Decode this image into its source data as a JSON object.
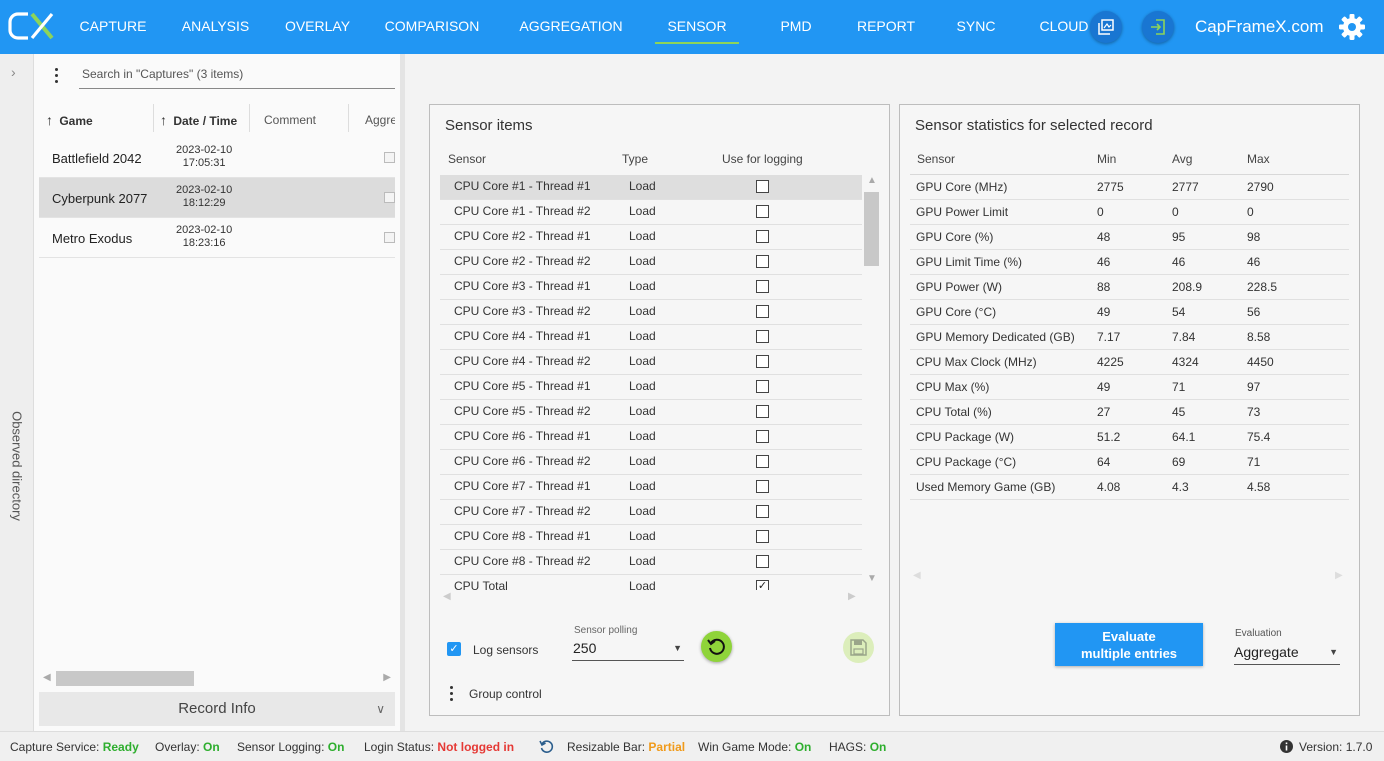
{
  "app": {
    "brand": "CapFrameX.com",
    "logo_text": "CX",
    "accent_color": "#2196f3",
    "active_tab_indicator_color": "#8dd45a"
  },
  "nav": {
    "tabs": [
      {
        "label": "CAPTURE",
        "active": false
      },
      {
        "label": "ANALYSIS",
        "active": false
      },
      {
        "label": "OVERLAY",
        "active": false
      },
      {
        "label": "COMPARISON",
        "active": false
      },
      {
        "label": "AGGREGATION",
        "active": false
      },
      {
        "label": "SENSOR",
        "active": true
      },
      {
        "label": "PMD",
        "active": false
      },
      {
        "label": "REPORT",
        "active": false
      },
      {
        "label": "SYNC",
        "active": false
      },
      {
        "label": "CLOUD",
        "active": false
      }
    ],
    "icons": [
      "screenshot-icon",
      "login-icon",
      "gear-icon"
    ]
  },
  "captures": {
    "sidebar_label": "Observed directory",
    "search_placeholder": "Search in \"Captures\" (3 items)",
    "columns": {
      "game": "Game",
      "date": "Date / Time",
      "comment": "Comment",
      "aggregated": "Aggre"
    },
    "rows": [
      {
        "game": "Battlefield 2042",
        "date": "2023-02-10",
        "time": "17:05:31",
        "selected": false
      },
      {
        "game": "Cyberpunk 2077",
        "date": "2023-02-10",
        "time": "18:12:29",
        "selected": true
      },
      {
        "game": "Metro Exodus",
        "date": "2023-02-10",
        "time": "18:23:16",
        "selected": false
      }
    ],
    "record_info": "Record Info"
  },
  "sensor_items": {
    "title": "Sensor items",
    "columns": {
      "sensor": "Sensor",
      "type": "Type",
      "use": "Use for logging"
    },
    "rows": [
      {
        "name": "CPU Core #1 - Thread #1",
        "type": "Load",
        "checked": false,
        "selected": true
      },
      {
        "name": "CPU Core #1 - Thread #2",
        "type": "Load",
        "checked": false,
        "selected": false
      },
      {
        "name": "CPU Core #2 - Thread #1",
        "type": "Load",
        "checked": false,
        "selected": false
      },
      {
        "name": "CPU Core #2 - Thread #2",
        "type": "Load",
        "checked": false,
        "selected": false
      },
      {
        "name": "CPU Core #3 - Thread #1",
        "type": "Load",
        "checked": false,
        "selected": false
      },
      {
        "name": "CPU Core #3 - Thread #2",
        "type": "Load",
        "checked": false,
        "selected": false
      },
      {
        "name": "CPU Core #4 - Thread #1",
        "type": "Load",
        "checked": false,
        "selected": false
      },
      {
        "name": "CPU Core #4 - Thread #2",
        "type": "Load",
        "checked": false,
        "selected": false
      },
      {
        "name": "CPU Core #5 - Thread #1",
        "type": "Load",
        "checked": false,
        "selected": false
      },
      {
        "name": "CPU Core #5 - Thread #2",
        "type": "Load",
        "checked": false,
        "selected": false
      },
      {
        "name": "CPU Core #6 - Thread #1",
        "type": "Load",
        "checked": false,
        "selected": false
      },
      {
        "name": "CPU Core #6 - Thread #2",
        "type": "Load",
        "checked": false,
        "selected": false
      },
      {
        "name": "CPU Core #7 - Thread #1",
        "type": "Load",
        "checked": false,
        "selected": false
      },
      {
        "name": "CPU Core #7 - Thread #2",
        "type": "Load",
        "checked": false,
        "selected": false
      },
      {
        "name": "CPU Core #8 - Thread #1",
        "type": "Load",
        "checked": false,
        "selected": false
      },
      {
        "name": "CPU Core #8 - Thread #2",
        "type": "Load",
        "checked": false,
        "selected": false
      },
      {
        "name": "CPU Total",
        "type": "Load",
        "checked": true,
        "selected": false
      }
    ],
    "log_sensors_label": "Log sensors",
    "log_sensors_checked": true,
    "polling_label": "Sensor polling",
    "polling_value": "250",
    "group_control_label": "Group control"
  },
  "statistics": {
    "title": "Sensor statistics for selected record",
    "columns": {
      "sensor": "Sensor",
      "min": "Min",
      "avg": "Avg",
      "max": "Max"
    },
    "rows": [
      {
        "sensor": "GPU Core (MHz)",
        "min": "2775",
        "avg": "2777",
        "max": "2790"
      },
      {
        "sensor": "GPU Power Limit",
        "min": "0",
        "avg": "0",
        "max": "0"
      },
      {
        "sensor": "GPU Core (%)",
        "min": "48",
        "avg": "95",
        "max": "98"
      },
      {
        "sensor": "GPU Limit Time (%)",
        "min": "46",
        "avg": "46",
        "max": "46"
      },
      {
        "sensor": "GPU Power (W)",
        "min": "88",
        "avg": "208.9",
        "max": "228.5"
      },
      {
        "sensor": "GPU Core (°C)",
        "min": "49",
        "avg": "54",
        "max": "56"
      },
      {
        "sensor": "GPU Memory Dedicated (GB)",
        "min": "7.17",
        "avg": "7.84",
        "max": "8.58"
      },
      {
        "sensor": "CPU Max Clock (MHz)",
        "min": "4225",
        "avg": "4324",
        "max": "4450"
      },
      {
        "sensor": "CPU Max (%)",
        "min": "49",
        "avg": "71",
        "max": "97"
      },
      {
        "sensor": "CPU Total (%)",
        "min": "27",
        "avg": "45",
        "max": "73"
      },
      {
        "sensor": "CPU Package (W)",
        "min": "51.2",
        "avg": "64.1",
        "max": "75.4"
      },
      {
        "sensor": "CPU Package (°C)",
        "min": "64",
        "avg": "69",
        "max": "71"
      },
      {
        "sensor": "Used Memory Game (GB)",
        "min": "4.08",
        "avg": "4.3",
        "max": "4.58"
      }
    ],
    "evaluate_line1": "Evaluate",
    "evaluate_line2": "multiple entries",
    "evaluation_label": "Evaluation",
    "evaluation_value": "Aggregate"
  },
  "status": {
    "capture_service_label": "Capture Service:",
    "capture_service_value": "Ready",
    "overlay_label": "Overlay:",
    "overlay_value": "On",
    "sensor_logging_label": "Sensor Logging:",
    "sensor_logging_value": "On",
    "login_label": "Login Status:",
    "login_value": "Not logged in",
    "resizable_bar_label": "Resizable Bar:",
    "resizable_bar_value": "Partial",
    "win_game_mode_label": "Win Game Mode:",
    "win_game_mode_value": "On",
    "hags_label": "HAGS:",
    "hags_value": "On",
    "version_label": "Version:",
    "version_value": "1.7.0",
    "colors": {
      "ok": "#2eae2e",
      "bad": "#e53935",
      "warn": "#f09a1a"
    }
  }
}
